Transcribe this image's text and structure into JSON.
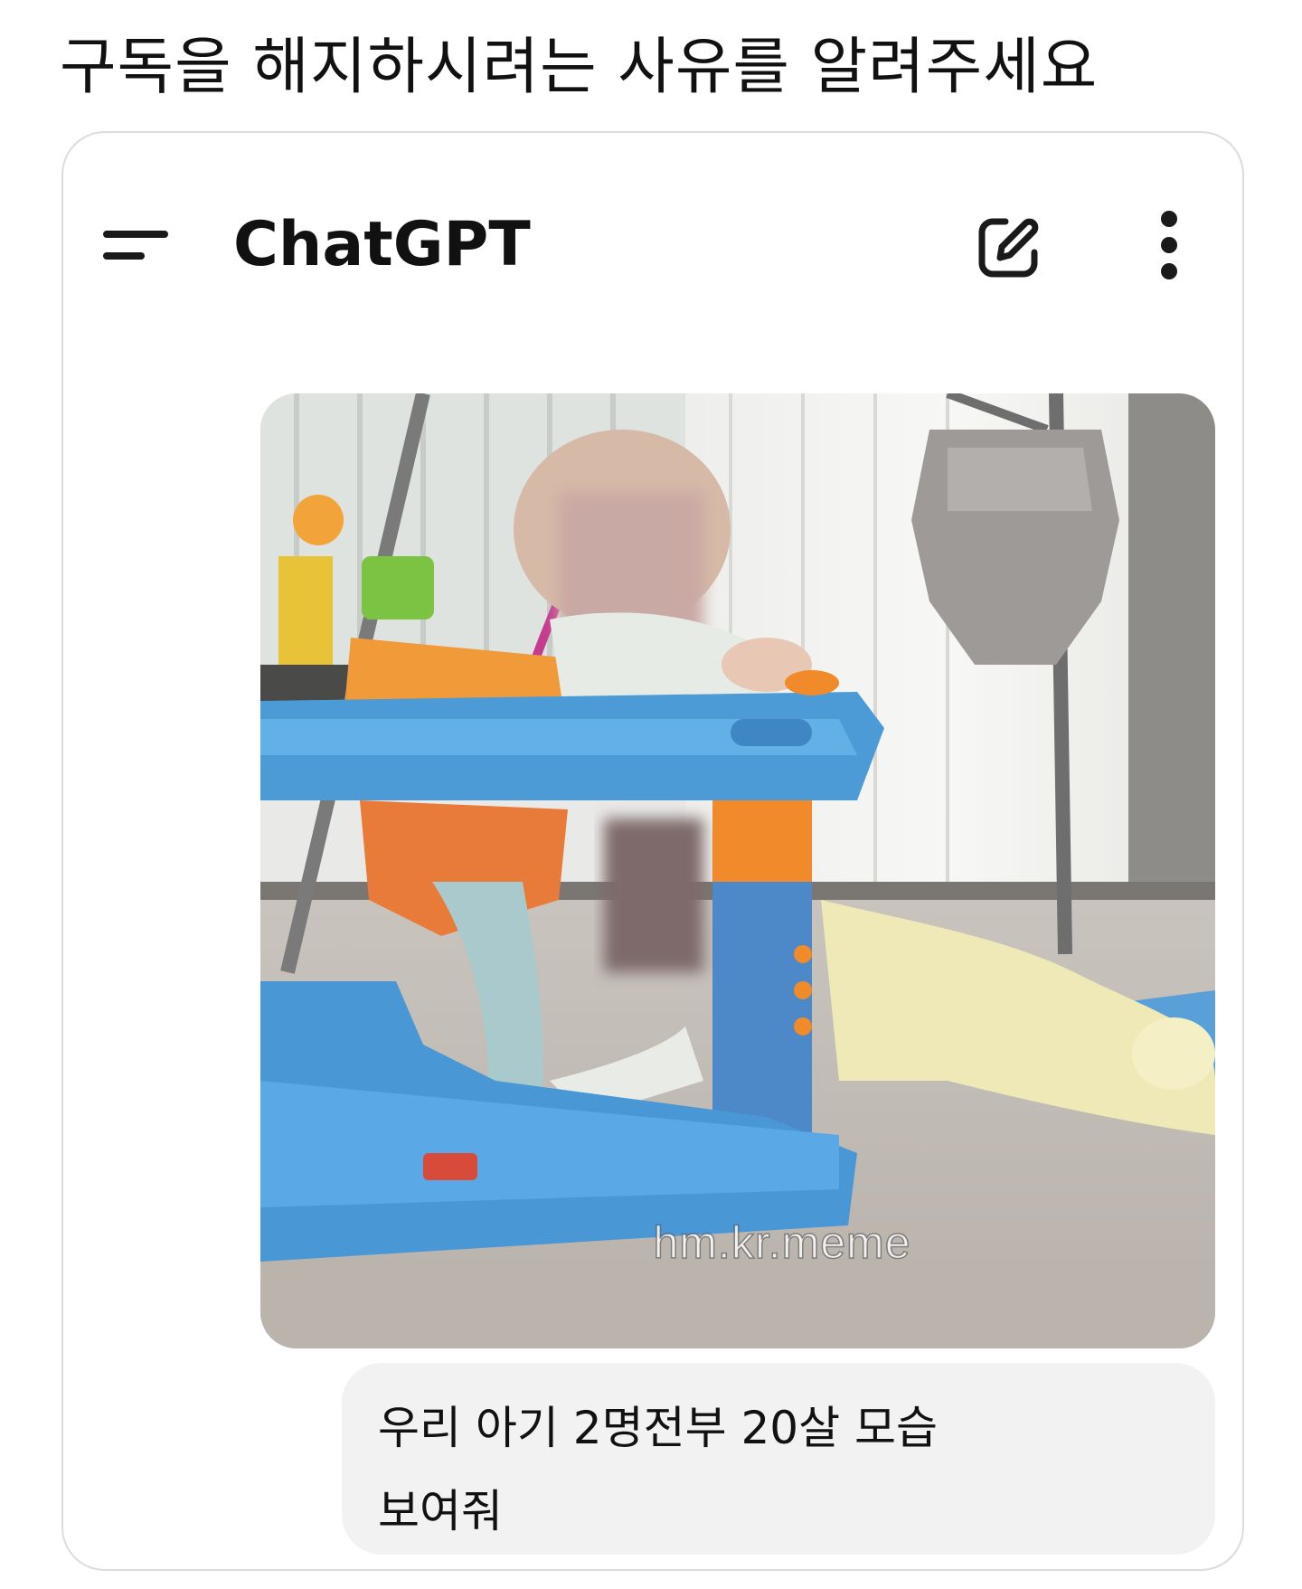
{
  "page": {
    "heading": "구독을 해지하시려는 사유를 알려주세요"
  },
  "app": {
    "title": "ChatGPT",
    "icons": {
      "menu": "menu-icon",
      "new_chat": "edit-icon",
      "more": "more-vertical-icon"
    }
  },
  "conversation": {
    "user_message": {
      "image_watermark": "hm.kr.meme",
      "text": "우리 아기 2명전부 20살 모습 보여줘"
    }
  },
  "colors": {
    "background": "#ffffff",
    "frame_border": "#dcdcdc",
    "bubble_background": "#f2f2f2",
    "text": "#111111",
    "icon": "#1a1a1a"
  }
}
